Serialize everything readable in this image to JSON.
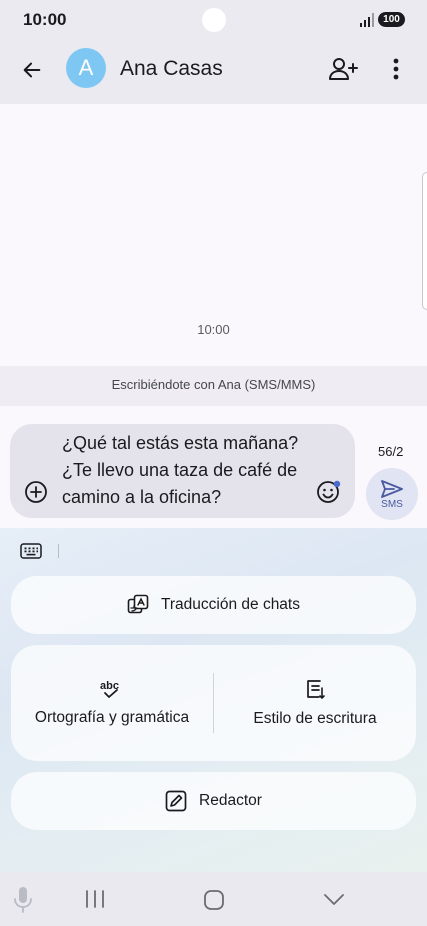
{
  "status_bar": {
    "time": "10:00",
    "battery": "100",
    "signal_icon": "signal-icon"
  },
  "header": {
    "contact_initial": "A",
    "contact_name": "Ana Casas",
    "back_icon": "arrow-back-icon",
    "add_person_icon": "person-add-icon",
    "more_icon": "more-vert-icon"
  },
  "conversation": {
    "timestamp": "10:00",
    "chat_info": "Escribiéndote con Ana (SMS/MMS)"
  },
  "compose": {
    "text": "¿Qué tal estás esta mañana? ¿Te llevo una taza de café de camino a la oficina?",
    "char_count": "56/2",
    "send_label": "SMS",
    "attach_icon": "add-circle-icon",
    "emoji_icon": "emoji-icon",
    "send_icon": "send-icon"
  },
  "assist": {
    "keyboard_icon": "keyboard-icon",
    "translate_label": "Traducción de chats",
    "spelling_label": "Ortografía y gramática",
    "style_label": "Estilo de escritura",
    "composer_label": "Redactor"
  },
  "nav": {
    "mic_icon": "microphone-icon",
    "recents_icon": "recents-icon",
    "home_icon": "home-icon",
    "back_icon": "chevron-down-icon"
  },
  "colors": {
    "avatar": "#7ec7f3",
    "header_bg": "#ebeaf1",
    "accent": "#4a5aa0"
  }
}
